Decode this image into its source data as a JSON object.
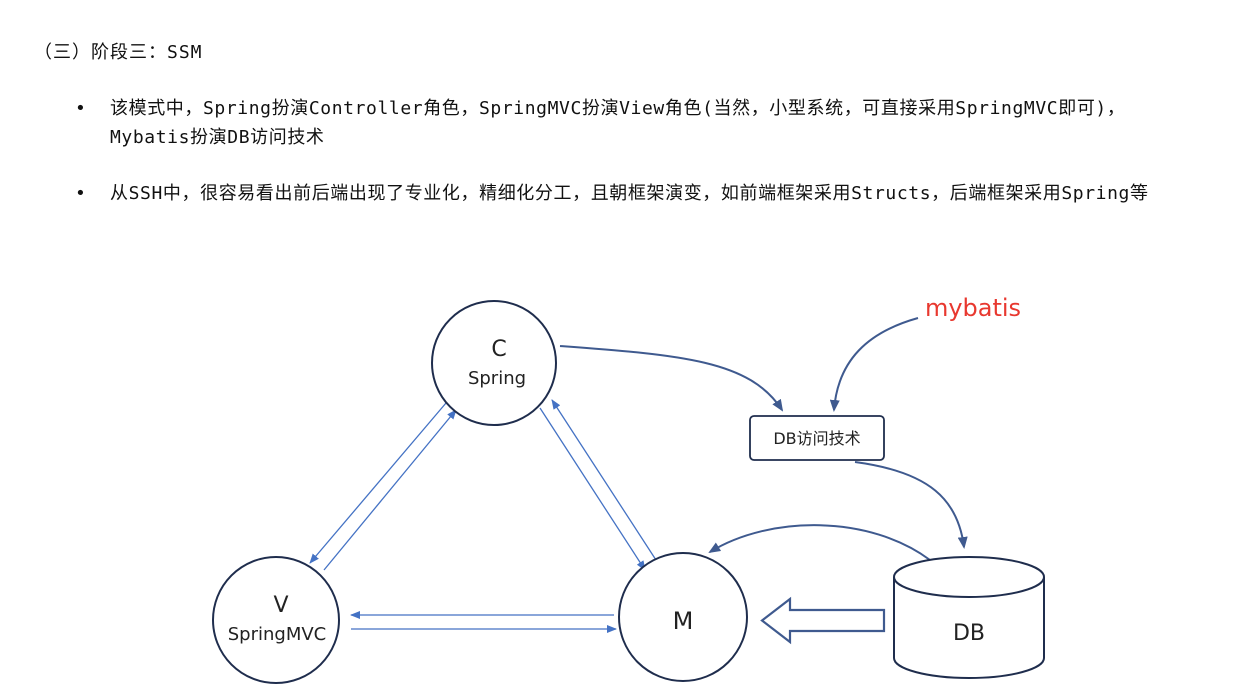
{
  "heading": "（三）阶段三：SSM",
  "bullets": [
    "该模式中，Spring扮演Controller角色，SpringMVC扮演View角色(当然，小型系统，可直接采用SpringMVC即可)，Mybatis扮演DB访问技术",
    "从SSH中，很容易看出前后端出现了专业化，精细化分工，且朝框架演变，如前端框架采用Structs，后端框架采用Spring等"
  ],
  "diagram": {
    "node_c": {
      "letter": "C",
      "label": "Spring"
    },
    "node_v": {
      "letter": "V",
      "label": "SpringMVC"
    },
    "node_m": {
      "letter": "M"
    },
    "db_access_box": "DB访问技术",
    "db_cylinder": "DB",
    "mybatis_label": "mybatis",
    "colors": {
      "arrow": "#3f5a8f",
      "arrow_light": "#4472c4",
      "stroke": "#1f2d4d",
      "mybatis": "#e8382f"
    }
  }
}
